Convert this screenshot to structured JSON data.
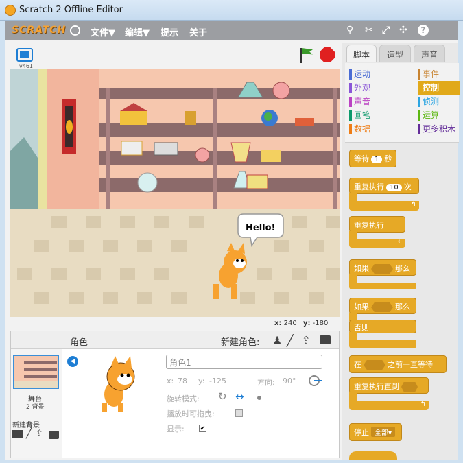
{
  "window": {
    "title": "Scratch 2 Offline Editor"
  },
  "menubar": {
    "logo": "SCRATCH",
    "items": [
      "文件▼",
      "编辑▼",
      "提示",
      "关于"
    ]
  },
  "stage": {
    "version": "v461",
    "speech": "Hello!",
    "coords_x_label": "x:",
    "coords_x": "240",
    "coords_y_label": "y:",
    "coords_y": "-180"
  },
  "tabs": [
    "脚本",
    "造型",
    "声音"
  ],
  "categories": {
    "left": [
      {
        "label": "运动",
        "color": "#4a6cd4"
      },
      {
        "label": "外观",
        "color": "#8a55d7"
      },
      {
        "label": "声音",
        "color": "#bb42c3"
      },
      {
        "label": "画笔",
        "color": "#0e9a6c"
      },
      {
        "label": "数据",
        "color": "#ee7d16"
      }
    ],
    "right": [
      {
        "label": "事件",
        "color": "#c88330"
      },
      {
        "label": "控制",
        "color": "#e1a91a"
      },
      {
        "label": "侦测",
        "color": "#2ca5e2"
      },
      {
        "label": "运算",
        "color": "#5cb712"
      },
      {
        "label": "更多积木",
        "color": "#632d99"
      }
    ]
  },
  "blocks": {
    "wait": "等待",
    "wait_val": "1",
    "wait_unit": "秒",
    "repeat": "重复执行",
    "repeat_val": "10",
    "repeat_unit": "次",
    "forever": "重复执行",
    "if": "如果",
    "then": "那么",
    "if2": "如果",
    "then2": "那么",
    "else": "否则",
    "waituntil_pre": "在",
    "waituntil_post": "之前一直等待",
    "repeatuntil": "重复执行直到",
    "stop": "停止",
    "stop_val": "全部▾"
  },
  "sprites": {
    "header": "角色",
    "new_sprite": "新建角色:",
    "stage_label": "舞台",
    "backdrops": "2 背景",
    "new_backdrop": "新建背景",
    "name_value": "角色1",
    "x_label": "x:",
    "x": "78",
    "y_label": "y:",
    "y": "-125",
    "dir_label": "方向:",
    "dir": "90°",
    "rotation_label": "旋转模式:",
    "draggable_label": "播放时可拖曳:",
    "show_label": "显示:"
  }
}
